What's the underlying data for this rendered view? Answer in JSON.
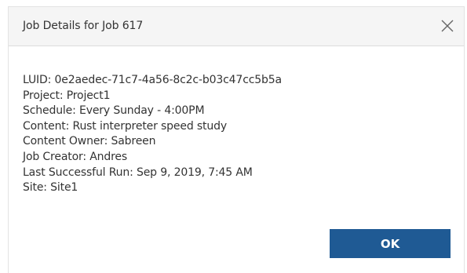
{
  "dialog": {
    "title": "Job Details for Job 617",
    "close_icon": "close-icon",
    "details": [
      "LUID: 0e2aedec-71c7-4a56-8c2c-b03c47cc5b5a",
      "Project: Project1",
      "Schedule: Every Sunday - 4:00PM",
      "Content: Rust interpreter speed study",
      "Content Owner: Sabreen",
      "Job Creator: Andres",
      "Last Successful Run: Sep 9, 2019, 7:45 AM",
      "Site: Site1"
    ],
    "ok_label": "OK"
  },
  "colors": {
    "header_bg": "#f5f5f5",
    "primary_button": "#1f5a94",
    "text": "#333333"
  }
}
